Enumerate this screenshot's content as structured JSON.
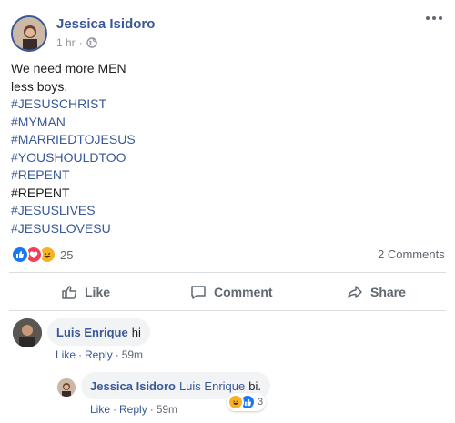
{
  "post": {
    "author": "Jessica Isidoro",
    "time": "1 hr",
    "separator": "·",
    "lines": [
      {
        "text": "We need more MEN",
        "kind": "plain"
      },
      {
        "text": "less boys.",
        "kind": "plain"
      },
      {
        "text": "#JESUSCHRIST",
        "kind": "hashtag"
      },
      {
        "text": "#MYMAN",
        "kind": "hashtag"
      },
      {
        "text": "#MARRIEDTOJESUS",
        "kind": "hashtag"
      },
      {
        "text": "#YOUSHOULDTOO",
        "kind": "hashtag"
      },
      {
        "text": "#REPENT",
        "kind": "hashtag"
      },
      {
        "text": "#REPENT",
        "kind": "plain"
      },
      {
        "text": "#JESUSLIVES",
        "kind": "hashtag"
      },
      {
        "text": "#JESUSLOVESU",
        "kind": "hashtag"
      }
    ],
    "reaction_count": "25",
    "comments_count": "2 Comments",
    "reaction_icons": [
      "like-icon",
      "love-icon",
      "haha-icon"
    ]
  },
  "actions": {
    "like": "Like",
    "comment": "Comment",
    "share": "Share"
  },
  "comments": [
    {
      "author": "Luis Enrique",
      "text": "hi",
      "like": "Like",
      "reply": "Reply",
      "time": "59m",
      "dot": "·"
    }
  ],
  "reply": {
    "author": "Jessica Isidoro",
    "mention": "Luis Enrique",
    "text": "bi.",
    "like": "Like",
    "reply": "Reply",
    "time": "59m",
    "dot": "·",
    "reaction_count": "3"
  },
  "colors": {
    "link": "#385898",
    "like_blue": "#1877f2",
    "love_red": "#f33e58",
    "haha_yellow": "#f7b125"
  }
}
